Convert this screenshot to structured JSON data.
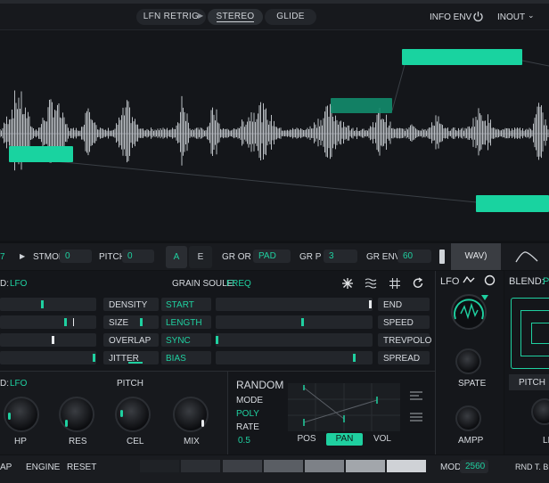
{
  "topbar": {
    "lfn_retrig": "LFN RETRIG",
    "stereo": "STEREO",
    "glide": "GLIDE",
    "info_env": "INFO ENV",
    "inout": "INOUT"
  },
  "modbar": {
    "left_value": "7",
    "stmod_label": "STMOD",
    "stmod_value": "0",
    "pitch_label": "PITCH",
    "pitch_value": "0",
    "a_button": "A",
    "e_button": "E",
    "gr_or_label": "GR OR",
    "gr_or_value": "PAD",
    "gr_pj_label": "GR P J",
    "gr_pj_value": "3",
    "gr_env_label": "GR ENV",
    "gr_env_value": "60",
    "wave_tab": "WAV)"
  },
  "grain": {
    "left_mod": "D:",
    "left_mod_value": "LFO",
    "source_label": "GRAIN SOULE:",
    "source_value": "FREQ",
    "labels_left": [
      "DENSITY",
      "SIZE",
      "OVERLAP",
      "JITTER"
    ],
    "labels_mid": [
      "START",
      "LENGTH",
      "SYNC",
      "BIAS"
    ],
    "labels_right": [
      "END",
      "SPEED",
      "TREVPOLO",
      "SPREAD"
    ],
    "lfo_label": "LFO",
    "blend_label": "BLEND:",
    "blend_value": "P"
  },
  "filter": {
    "mod_label": "D:",
    "mod_value": "LFO",
    "pitch_label": "PITCH",
    "knobs": [
      "HP",
      "RES",
      "CEL",
      "MIX"
    ]
  },
  "random": {
    "title": "RANDOM",
    "mode_label": "MODE",
    "mode_value": "POLY",
    "rate_label": "RATE",
    "rate_value": "0.5",
    "tabs": [
      "POS",
      "PAN",
      "VOL"
    ],
    "active_tab": "PAN"
  },
  "rightcol": {
    "spate": "SPATE",
    "ampp": "AMPP",
    "pitch": "PITCH",
    "li": "LI"
  },
  "footer": {
    "ap": "AP",
    "engine": "ENGINE",
    "reset": "RESET",
    "mod_label": "MOD",
    "mod_value": "2560",
    "rnd": "RND T. BL"
  },
  "colors": {
    "accent": "#1fd0a0",
    "background": "#101215",
    "panel": "#17191d"
  }
}
